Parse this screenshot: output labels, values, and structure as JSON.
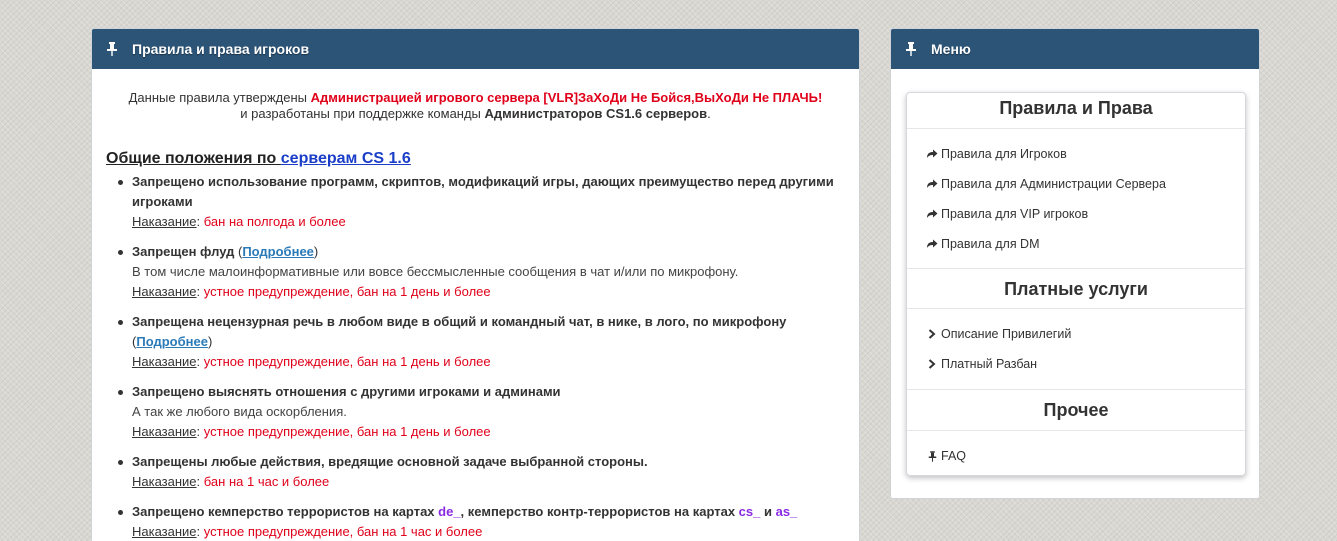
{
  "left_panel": {
    "title": "Правила и права игроков",
    "intro": {
      "line1_prefix": "Данные правила утверждены ",
      "line1_red": "Администрацией игрового сервера [VLR]ЗаХоДи Не Бойся,ВыХоДи Не ПЛАЧЬ!",
      "line2_prefix": "и разработаны при поддержке команды ",
      "line2_bold": "Администраторов CS1.6 серверов",
      "line2_suffix": "."
    },
    "section": {
      "title_prefix": "Общие положения по ",
      "title_link": "серверам CS 1.6"
    },
    "punish_label": "Наказание",
    "more_label": "Подробнее",
    "rules": [
      {
        "title": "Запрещено использование программ, скриптов, модификаций игры, дающих преимущество перед другими игроками",
        "punish": "бан на полгода и более"
      },
      {
        "title": "Запрещен флуд",
        "desc": "В том числе малоинформативные или вовсе бессмысленные сообщения в чат и/или по микрофону.",
        "punish": "устное предупреждение, бан на 1 день и более"
      },
      {
        "title": "Запрещена нецензурная речь в любом виде в общий и командный чат, в нике, в лого, по микрофону",
        "punish": "устное предупреждение, бан на 1 день и более"
      },
      {
        "title": "Запрещено выяснять отношения с другими игроками и админами",
        "desc": "А так же любого вида оскорбления.",
        "punish": "устное предупреждение, бан на 1 день и более"
      },
      {
        "title": "Запрещены любые действия, вредящие основной задаче выбранной стороны.",
        "punish": "бан на 1 час и более"
      },
      {
        "title_part1": "Запрещено кемперство террористов на картах ",
        "map1": "de_",
        "title_part2": ", кемперство контр-террористов на картах ",
        "map2": "cs_",
        "title_part3": " и ",
        "map3": "as_",
        "punish": "устное предупреждение, бан на 1 час и более"
      }
    ]
  },
  "right_panel": {
    "title": "Меню",
    "groups": [
      {
        "title": "Правила и Права",
        "items": [
          "Правила для Игроков",
          "Правила для Администрации Сервера",
          "Правила для VIP игроков",
          "Правила для DM"
        ]
      },
      {
        "title": "Платные услуги",
        "items": [
          "Описание Привилегий",
          "Платный Разбан"
        ]
      },
      {
        "title": "Прочее",
        "items": [
          "FAQ"
        ]
      }
    ]
  },
  "icons": {
    "panel": "pin-icon",
    "rules_items": "share-arrow-icon",
    "paid_items": "chevron-right-icon",
    "other_items": "pin-icon"
  },
  "colors": {
    "header": "#2c5477",
    "red": "#e0001a",
    "link": "#2a7ab8",
    "purple": "#8a2be2"
  }
}
